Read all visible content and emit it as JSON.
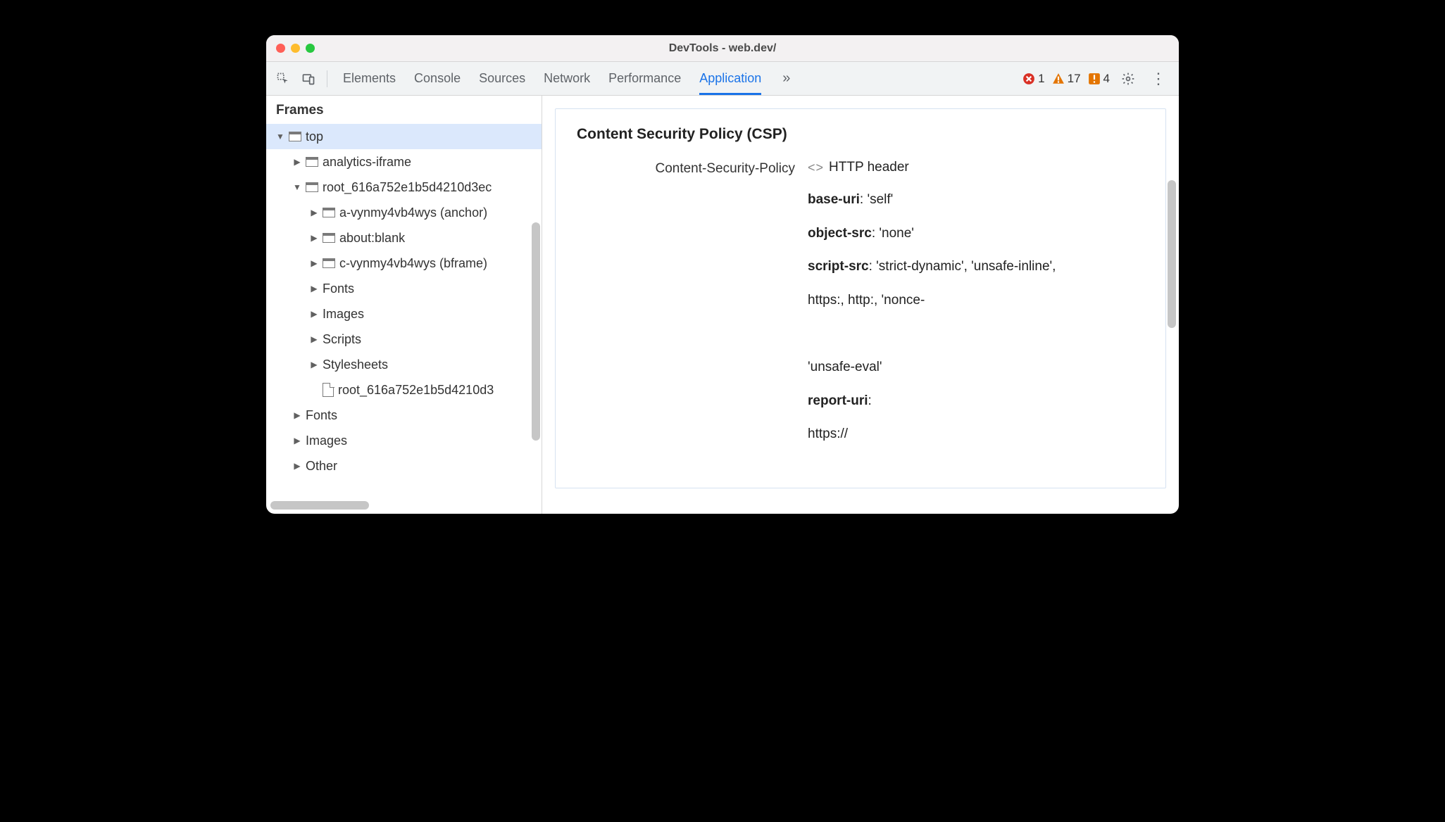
{
  "window": {
    "title": "DevTools - web.dev/"
  },
  "toolbar": {
    "tabs": [
      "Elements",
      "Console",
      "Sources",
      "Network",
      "Performance",
      "Application"
    ],
    "active_tab_index": 5,
    "overflow_glyph": "»",
    "errors_count": "1",
    "warnings_count": "17",
    "issues_count": "4"
  },
  "sidebar": {
    "header": "Frames",
    "tree": [
      {
        "indent": 0,
        "arrow": "expanded",
        "icon": "window",
        "label": "top",
        "selected": true
      },
      {
        "indent": 1,
        "arrow": "collapsed",
        "icon": "window",
        "label": "analytics-iframe"
      },
      {
        "indent": 1,
        "arrow": "expanded",
        "icon": "window",
        "label": "root_616a752e1b5d4210d3ec"
      },
      {
        "indent": 2,
        "arrow": "collapsed",
        "icon": "window",
        "label": "a-vynmy4vb4wys (anchor)"
      },
      {
        "indent": 2,
        "arrow": "collapsed",
        "icon": "window",
        "label": "about:blank"
      },
      {
        "indent": 2,
        "arrow": "collapsed",
        "icon": "window",
        "label": "c-vynmy4vb4wys (bframe)"
      },
      {
        "indent": 2,
        "arrow": "collapsed",
        "icon": "none",
        "label": "Fonts"
      },
      {
        "indent": 2,
        "arrow": "collapsed",
        "icon": "none",
        "label": "Images"
      },
      {
        "indent": 2,
        "arrow": "collapsed",
        "icon": "none",
        "label": "Scripts"
      },
      {
        "indent": 2,
        "arrow": "collapsed",
        "icon": "none",
        "label": "Stylesheets"
      },
      {
        "indent": 2,
        "arrow": "none",
        "icon": "doc",
        "label": "root_616a752e1b5d4210d3"
      },
      {
        "indent": 1,
        "arrow": "collapsed",
        "icon": "none",
        "label": "Fonts"
      },
      {
        "indent": 1,
        "arrow": "collapsed",
        "icon": "none",
        "label": "Images"
      },
      {
        "indent": 1,
        "arrow": "collapsed",
        "icon": "none",
        "label": "Other"
      }
    ]
  },
  "main": {
    "panel_title": "Content Security Policy (CSP)",
    "header_key": "Content-Security-Policy",
    "header_source": "HTTP header",
    "directives": [
      {
        "key": "base-uri",
        "value": ": 'self'"
      },
      {
        "key": "object-src",
        "value": ": 'none'"
      },
      {
        "key": "script-src",
        "value": ": 'strict-dynamic', 'unsafe-inline',"
      },
      {
        "key": "",
        "value": "https:, http:, 'nonce-"
      },
      {
        "key": "",
        "value": " "
      },
      {
        "key": "",
        "value": "'unsafe-eval'"
      },
      {
        "key": "report-uri",
        "value": ":"
      },
      {
        "key": "",
        "value": "https://"
      }
    ]
  }
}
